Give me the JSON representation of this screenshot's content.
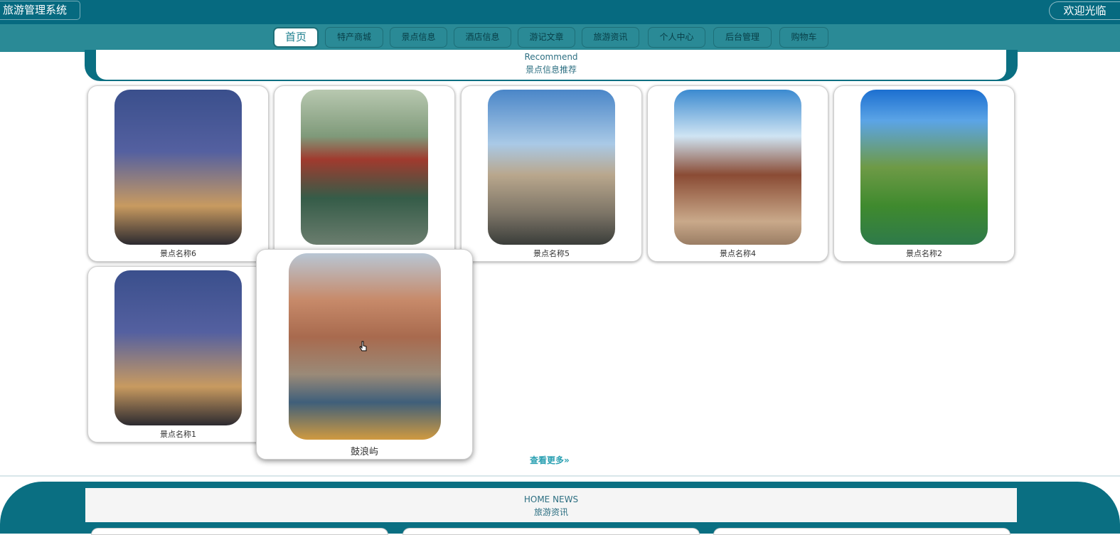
{
  "header": {
    "title": "旅游管理系统",
    "welcome": "欢迎光临"
  },
  "nav": [
    {
      "label": "首页",
      "active": true
    },
    {
      "label": "特产商城"
    },
    {
      "label": "景点信息"
    },
    {
      "label": "酒店信息"
    },
    {
      "label": "游记文章"
    },
    {
      "label": "旅游资讯"
    },
    {
      "label": "个人中心"
    },
    {
      "label": "后台管理"
    },
    {
      "label": "购物车"
    }
  ],
  "recommend": {
    "en": "Recommend",
    "cn": "景点信息推荐"
  },
  "attractions": [
    {
      "name": "景点名称6",
      "scene": "junk-boat-icon"
    },
    {
      "name": "",
      "scene": "pagoda-icon"
    },
    {
      "name": "景点名称5",
      "scene": "temple-icon"
    },
    {
      "name": "景点名称4",
      "scene": "city-gate-icon"
    },
    {
      "name": "景点名称2",
      "scene": "cliff-river-icon"
    },
    {
      "name": "景点名称1",
      "scene": "junk-boat-icon"
    },
    {
      "name": "鼓浪屿",
      "scene": "seaside-village-icon"
    }
  ],
  "more_label": "查看更多",
  "news": {
    "en": "HOME NEWS",
    "cn": "旅游资讯"
  },
  "colors": {
    "primary": "#066a80",
    "nav": "#2a8a96",
    "link": "#2aa0b2"
  }
}
